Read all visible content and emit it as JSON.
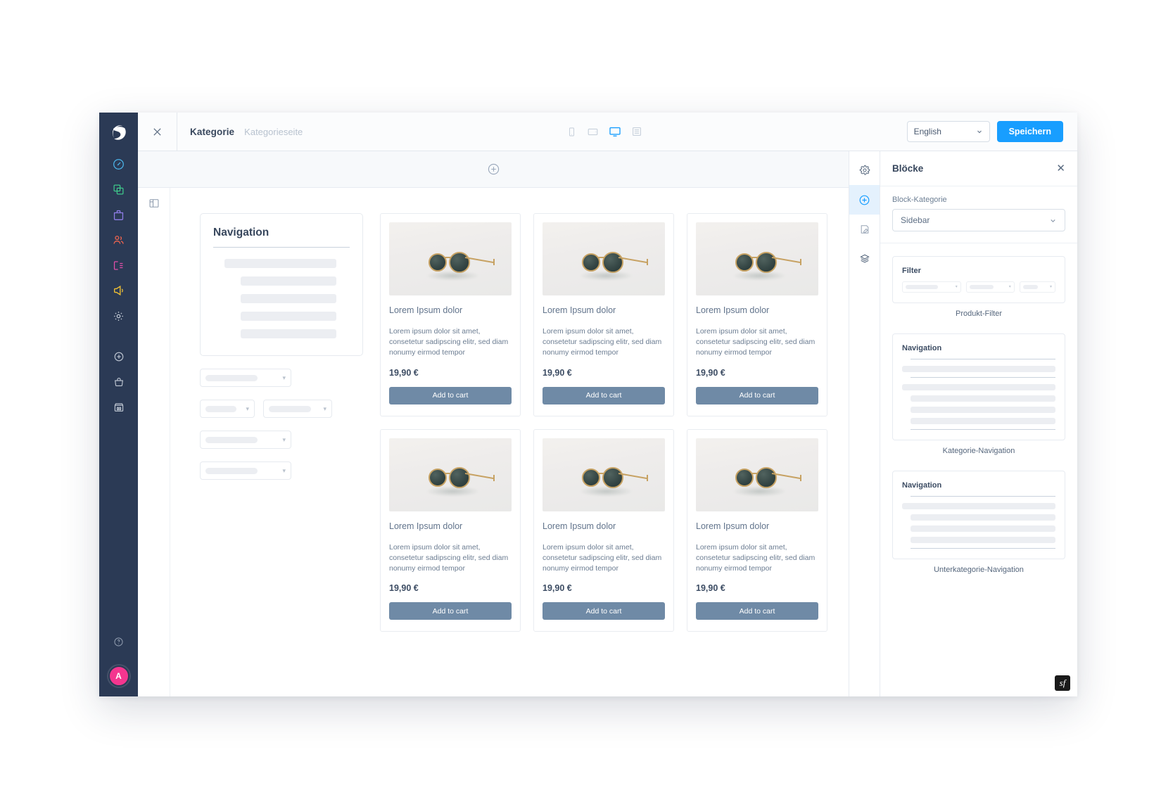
{
  "app": {
    "brand_icon": "shopware-logo-icon",
    "avatar_initial": "A",
    "avatar_color": "#f4368f",
    "rail_bg": "#2b3a55"
  },
  "rail": {
    "items": [
      {
        "name": "dashboard-icon",
        "color": "#4bb3e8"
      },
      {
        "name": "catalogues-icon",
        "color": "#3ec78a"
      },
      {
        "name": "orders-icon",
        "color": "#8f7de8"
      },
      {
        "name": "customers-icon",
        "color": "#f0644e"
      },
      {
        "name": "content-icon",
        "color": "#e04ea8"
      },
      {
        "name": "marketing-icon",
        "color": "#f2c233"
      },
      {
        "name": "settings-icon",
        "color": "#c3cbd6"
      }
    ],
    "secondary": [
      {
        "name": "extensions-add-icon",
        "color": "#c3cbd6"
      },
      {
        "name": "store-bag-icon",
        "color": "#c3cbd6"
      },
      {
        "name": "my-extensions-icon",
        "color": "#c3cbd6"
      }
    ],
    "footer": [
      {
        "name": "help-info-icon",
        "color": "#8c98ab"
      }
    ]
  },
  "topbar": {
    "close_icon": "close-icon",
    "breadcrumb_title": "Kategorie",
    "breadcrumb_sub": "Kategorieseite",
    "devices": [
      {
        "name": "device-mobile-icon",
        "active": false
      },
      {
        "name": "device-tablet-icon",
        "active": false
      },
      {
        "name": "device-desktop-icon",
        "active": true
      },
      {
        "name": "device-list-icon",
        "active": false
      }
    ],
    "language": "English",
    "language_chevron": "chevron-down-icon",
    "save_label": "Speichern",
    "accent_color": "#189eff"
  },
  "editor": {
    "add_section_icon": "plus-circle-icon",
    "layout_icon": "layout-columns-icon"
  },
  "canvas": {
    "sidebar_nav": {
      "title": "Navigation",
      "placeholder_rows": 5
    },
    "sidebar_selects": [
      {
        "name": "select-filter-1"
      },
      {
        "name": "select-filter-2a"
      },
      {
        "name": "select-filter-2b"
      },
      {
        "name": "select-filter-3"
      },
      {
        "name": "select-filter-4"
      }
    ],
    "products": [
      {
        "title": "Lorem Ipsum dolor",
        "desc": "Lorem ipsum dolor sit amet, consetetur sadipscing elitr, sed diam nonumy eirmod tempor",
        "price": "19,90 €",
        "cta": "Add to cart",
        "image": "sunglasses-product-image"
      },
      {
        "title": "Lorem Ipsum dolor",
        "desc": "Lorem ipsum dolor sit amet, consetetur sadipscing elitr, sed diam nonumy eirmod tempor",
        "price": "19,90 €",
        "cta": "Add to cart",
        "image": "sunglasses-product-image"
      },
      {
        "title": "Lorem Ipsum dolor",
        "desc": "Lorem ipsum dolor sit amet, consetetur sadipscing elitr, sed diam nonumy eirmod tempor",
        "price": "19,90 €",
        "cta": "Add to cart",
        "image": "sunglasses-product-image"
      },
      {
        "title": "Lorem Ipsum dolor",
        "desc": "Lorem ipsum dolor sit amet, consetetur sadipscing elitr, sed diam nonumy eirmod tempor",
        "price": "19,90 €",
        "cta": "Add to cart",
        "image": "sunglasses-product-image"
      },
      {
        "title": "Lorem Ipsum dolor",
        "desc": "Lorem ipsum dolor sit amet, consetetur sadipscing elitr, sed diam nonumy eirmod tempor",
        "price": "19,90 €",
        "cta": "Add to cart",
        "image": "sunglasses-product-image"
      },
      {
        "title": "Lorem Ipsum dolor",
        "desc": "Lorem ipsum dolor sit amet, consetetur sadipscing elitr, sed diam nonumy eirmod tempor",
        "price": "19,90 €",
        "cta": "Add to cart",
        "image": "sunglasses-product-image"
      }
    ]
  },
  "panel_tabs": [
    {
      "name": "tab-settings",
      "icon": "gear-icon",
      "active": false
    },
    {
      "name": "tab-blocks",
      "icon": "plus-circle-icon",
      "active": true
    },
    {
      "name": "tab-edit",
      "icon": "edit-note-icon",
      "active": false
    },
    {
      "name": "tab-layers",
      "icon": "layers-icon",
      "active": false
    }
  ],
  "panel": {
    "title": "Blöcke",
    "close_icon": "close-icon",
    "category_label": "Block-Kategorie",
    "category_value": "Sidebar",
    "category_chevron": "chevron-down-icon",
    "blocks": [
      {
        "preview_title": "Filter",
        "caption": "Produkt-Filter",
        "kind": "filter"
      },
      {
        "preview_title": "Navigation",
        "caption": "Kategorie-Navigation",
        "kind": "nav-category"
      },
      {
        "preview_title": "Navigation",
        "caption": "Unterkategorie-Navigation",
        "kind": "nav-subcategory"
      }
    ]
  },
  "footer_badge": {
    "name": "symfony-badge",
    "glyph": "sf"
  }
}
